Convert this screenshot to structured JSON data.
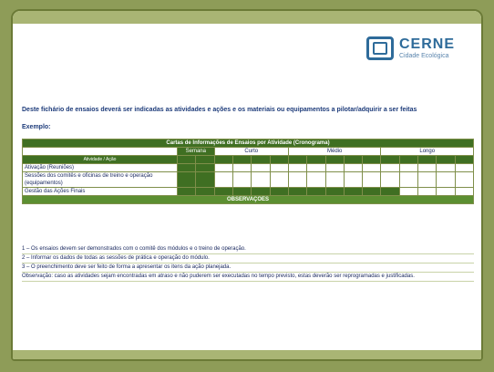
{
  "logo": {
    "name": "CERNE",
    "sub": "Cidade Ecológica"
  },
  "intro": "Deste fichário de ensaios deverá ser indicadas as atividades e ações e os materiais ou equipamentos a pilotar/adquirir a ser feitas",
  "intro2": "Exemplo:",
  "table": {
    "title": "Cartas de Informações de Ensaios por Atividade (Cronograma)",
    "groups": [
      "Semana",
      "Curto",
      "Médio",
      "Longo"
    ],
    "activity_header": "Atividade / Ação",
    "rows": [
      {
        "label": "Ativação (Reuniões)",
        "filled": [
          0,
          1
        ]
      },
      {
        "label": "Sessões dos comitês e oficinas de treino e operação (equipamentos)",
        "filled": [
          0,
          1
        ]
      },
      {
        "label": "Gestão das Ações Finais",
        "filled": [
          0,
          1,
          2,
          3,
          4,
          5,
          6,
          7,
          8,
          9,
          10,
          11
        ]
      }
    ],
    "observations_label": "OBSERVAÇÕES"
  },
  "notes": [
    "1 – Os ensaios devem ser demonstrados com o comitê dos módulos e o treino de operação.",
    "2 – Informar os dados de todas as sessões de prática e operação do módulo.",
    "3 – O preenchimento deve ser feito de forma a apresentar os itens da ação planejada.",
    "Observação: caso as atividades sejam encontradas em atraso e não puderem ser executadas no tempo previsto, estas deverão ser reprogramadas e justificadas."
  ]
}
